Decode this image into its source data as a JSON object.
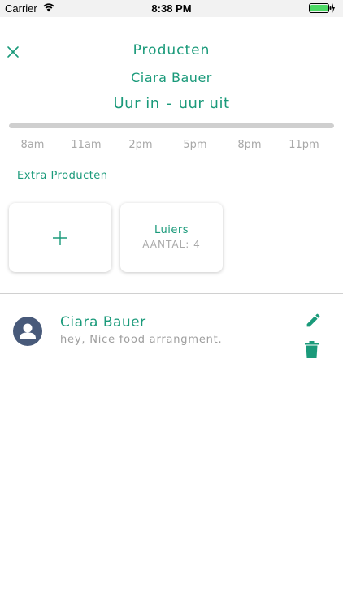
{
  "status_bar": {
    "carrier": "Carrier",
    "time": "8:38 PM",
    "icons": [
      "wifi-icon",
      "battery-icon",
      "charging-bolt-icon"
    ],
    "battery_color": "#4cd964"
  },
  "header": {
    "title": "Producten",
    "child_name": "Ciara Bauer",
    "hours_in": "Uur in",
    "hours_separator": "-",
    "hours_out": "uur uit",
    "close_icon": "close-icon"
  },
  "timeline": {
    "labels": [
      "8am",
      "11am",
      "2pm",
      "5pm",
      "8pm",
      "11pm"
    ]
  },
  "extra_products": {
    "title": "Extra Producten",
    "add_icon": "plus-icon",
    "items": [
      {
        "name": "Luiers",
        "quantity": "AANTAL: 4"
      }
    ]
  },
  "comments": [
    {
      "author": "Ciara Bauer",
      "text": "hey, Nice food arrangment.",
      "avatar_icon": "user-avatar-icon",
      "actions": [
        "edit-icon",
        "delete-icon"
      ]
    }
  ],
  "colors": {
    "accent": "#1a9a7a",
    "muted_text": "#a9a9a9",
    "avatar_bg": "#485a7a"
  }
}
